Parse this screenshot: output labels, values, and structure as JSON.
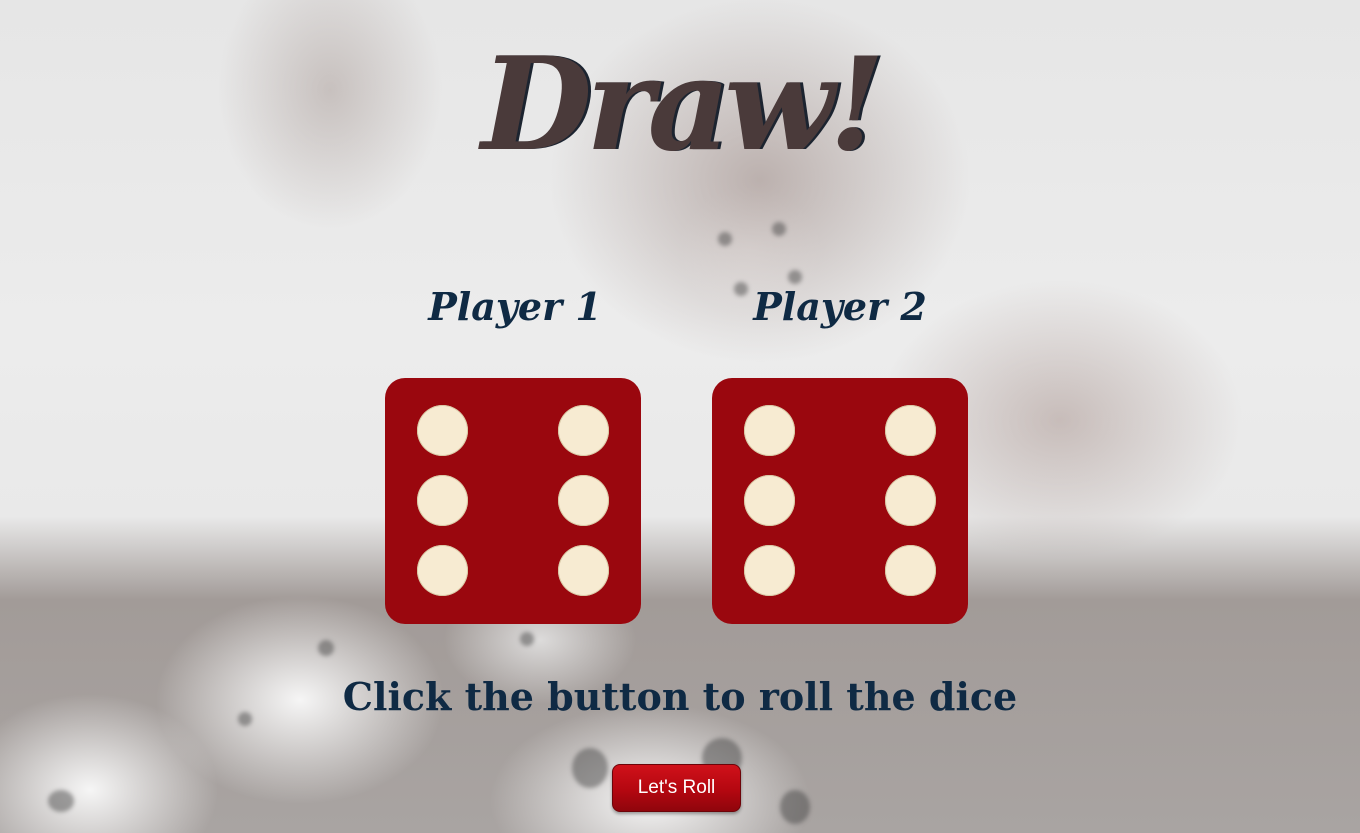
{
  "page": {
    "heading": "Draw!",
    "status_message": "Click the button to roll the dice"
  },
  "players": [
    {
      "label": "Player 1",
      "die_value": 6
    },
    {
      "label": "Player 2",
      "die_value": 6
    }
  ],
  "controls": {
    "roll_button_label": "Let's Roll"
  },
  "colors": {
    "heading": "#4a3a3a",
    "text": "#0f2a44",
    "die_face": "#9a070e",
    "pip": "#f7ebd2",
    "button": "#b40710"
  }
}
